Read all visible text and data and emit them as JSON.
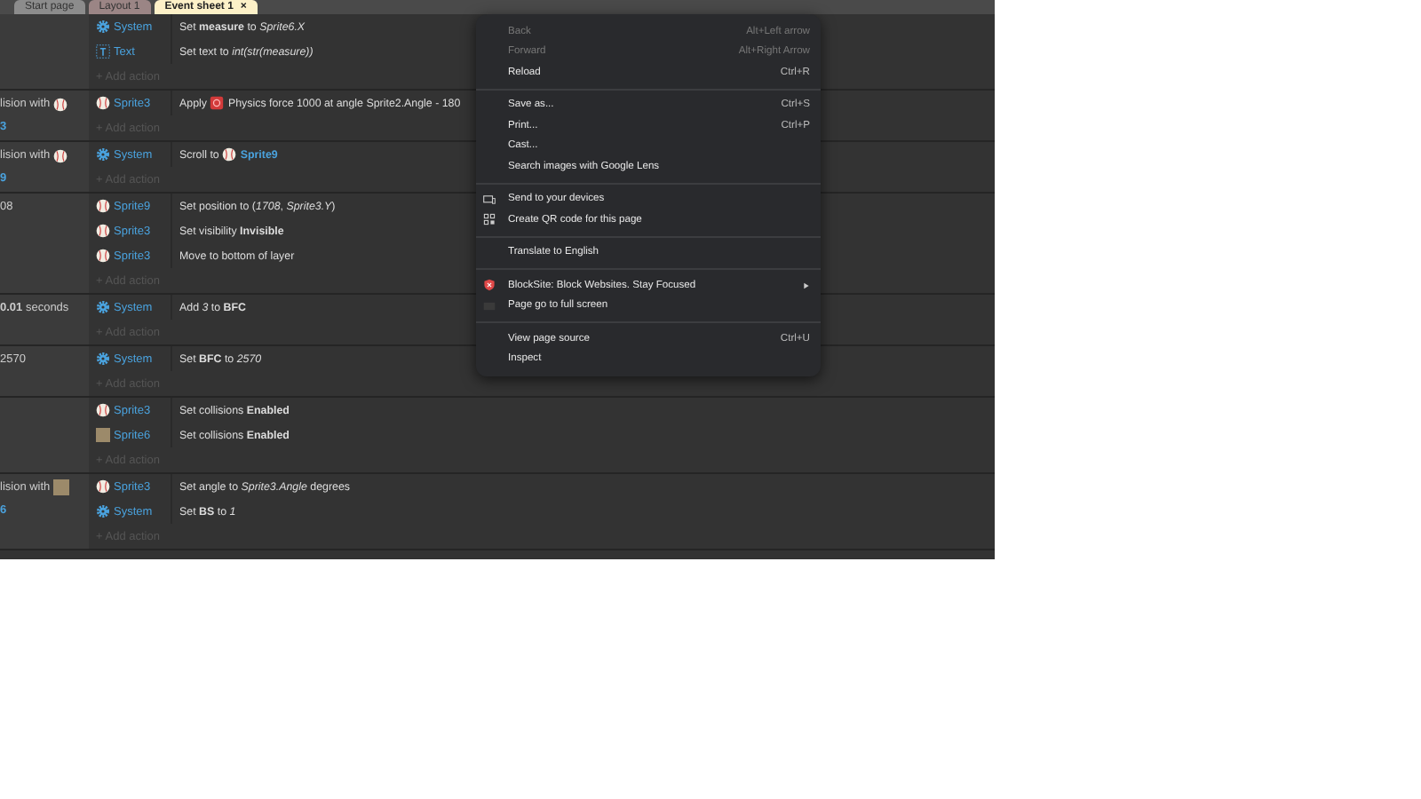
{
  "tabs": [
    {
      "label": "Start page",
      "selected": false
    },
    {
      "label": "Layout 1",
      "selected": false
    },
    {
      "label": "Event sheet 1",
      "selected": true,
      "close": "×"
    }
  ],
  "events": [
    {
      "actions": [
        {
          "object": "System",
          "kind": "system",
          "parts": [
            {
              "kind": "text",
              "text": "Set **measure** to *Sprite6.X*"
            }
          ]
        },
        {
          "object": "Text",
          "kind": "text",
          "parts": [
            {
              "kind": "text",
              "text": "Set text to *int(str(measure))*"
            }
          ]
        }
      ],
      "add_action": "+ Add action"
    },
    {
      "conditions": [
        {
          "text": "lision with",
          "kind": "sprite"
        },
        {
          "text": "3",
          "kind": "object"
        }
      ],
      "actions": [
        {
          "object": "Sprite3",
          "kind": "sprite",
          "parts": [
            {
              "kind": "text",
              "text": "Apply"
            },
            {
              "kind": "physics"
            },
            {
              "kind": "text",
              "text": "Physics force 1000 at angle Sprite2.Angle - 180"
            }
          ]
        }
      ],
      "add_action": "+ Add action"
    },
    {
      "conditions": [
        {
          "text": "lision with",
          "kind": "sprite"
        },
        {
          "text": "9",
          "kind": "object"
        }
      ],
      "actions": [
        {
          "object": "System",
          "kind": "system",
          "parts": [
            {
              "kind": "text",
              "text": "Scroll to"
            },
            {
              "kind": "sprite"
            },
            {
              "kind": "object",
              "text": "Sprite9"
            }
          ]
        }
      ],
      "add_action": "+ Add action"
    },
    {
      "conditions": [
        {
          "text": "08",
          "kind": "plain"
        }
      ],
      "actions": [
        {
          "object": "Sprite9",
          "kind": "sprite",
          "parts": [
            {
              "kind": "text",
              "text": "Set position to (*1708*, *Sprite3.Y*)"
            }
          ]
        },
        {
          "object": "Sprite3",
          "kind": "sprite",
          "parts": [
            {
              "kind": "text",
              "text": "Set visibility **Invisible**"
            }
          ]
        },
        {
          "object": "Sprite3",
          "kind": "sprite",
          "parts": [
            {
              "kind": "text",
              "text": "Move to bottom of layer"
            }
          ]
        }
      ],
      "add_action": "+ Add action"
    },
    {
      "conditions": [
        {
          "text": "**0.01** seconds",
          "kind": "plain"
        }
      ],
      "actions": [
        {
          "object": "System",
          "kind": "system",
          "parts": [
            {
              "kind": "text",
              "text": "Add *3* to **BFC**"
            }
          ]
        }
      ],
      "add_action": "+ Add action"
    },
    {
      "conditions": [
        {
          "text": "2570",
          "kind": "plain"
        }
      ],
      "actions": [
        {
          "object": "System",
          "kind": "system",
          "parts": [
            {
              "kind": "text",
              "text": "Set **BFC** to *2570*"
            }
          ]
        }
      ],
      "add_action": "+ Add action"
    },
    {
      "actions": [
        {
          "object": "Sprite3",
          "kind": "sprite",
          "parts": [
            {
              "kind": "text",
              "text": "Set collisions **Enabled**"
            }
          ]
        },
        {
          "object": "Sprite6",
          "kind": "tile",
          "parts": [
            {
              "kind": "text",
              "text": "Set collisions **Enabled**"
            }
          ]
        }
      ],
      "add_action": "+ Add action"
    },
    {
      "conditions": [
        {
          "text": "lision with",
          "kind": "tile"
        },
        {
          "text": "6",
          "kind": "object"
        }
      ],
      "actions": [
        {
          "object": "Sprite3",
          "kind": "sprite",
          "parts": [
            {
              "kind": "text",
              "text": "Set angle to *Sprite3.Angle* degrees"
            }
          ]
        },
        {
          "object": "System",
          "kind": "system",
          "parts": [
            {
              "kind": "text",
              "text": "Set **BS** to *1*"
            }
          ]
        }
      ],
      "add_action": "+ Add action"
    }
  ],
  "menu": {
    "groups": [
      [
        {
          "label": "Back",
          "shortcut": "Alt+Left arrow",
          "disabled": true
        },
        {
          "label": "Forward",
          "shortcut": "Alt+Right Arrow",
          "disabled": true
        },
        {
          "label": "Reload",
          "shortcut": "Ctrl+R",
          "disabled": false
        }
      ],
      [
        {
          "label": "Save as...",
          "shortcut": "Ctrl+S",
          "disabled": false
        },
        {
          "label": "Print...",
          "shortcut": "Ctrl+P",
          "disabled": false
        },
        {
          "label": "Cast...",
          "disabled": false
        },
        {
          "label": "Search images with Google Lens",
          "disabled": false
        }
      ],
      [
        {
          "label": "Send to your devices",
          "kind": "devices",
          "disabled": false
        },
        {
          "label": "Create QR code for this page",
          "kind": "qr",
          "disabled": false
        }
      ],
      [
        {
          "label": "Translate to English",
          "disabled": false
        }
      ],
      [
        {
          "label": "BlockSite: Block Websites. Stay Focused",
          "kind": "extension_submenu",
          "disabled": false
        },
        {
          "label": "Page go to full screen",
          "kind": "extension",
          "disabled": false
        }
      ],
      [
        {
          "label": "View page source",
          "shortcut": "Ctrl+U",
          "disabled": false
        },
        {
          "label": "Inspect",
          "disabled": false
        }
      ]
    ]
  }
}
